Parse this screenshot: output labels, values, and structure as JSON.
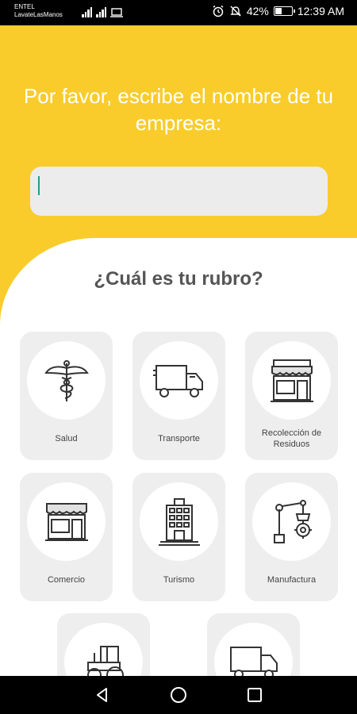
{
  "status_bar": {
    "carrier_line1": "ENTEL",
    "carrier_line2": "LavateLasManos",
    "battery_percent": "42%",
    "battery_level": 0.42,
    "time": "12:39 AM",
    "icons": [
      "signal-icon",
      "signal-4g-icon",
      "laptop-icon",
      "alarm-icon",
      "mute-icon",
      "battery-icon"
    ]
  },
  "header": {
    "prompt": "Por favor, escribe el nombre de tu empresa:",
    "company_input_value": "",
    "company_input_placeholder": ""
  },
  "main": {
    "question": "¿Cuál es tu rubro?",
    "categories": [
      {
        "label": "Salud",
        "icon": "caduceus-icon"
      },
      {
        "label": "Transporte",
        "icon": "truck-icon"
      },
      {
        "label": "Recolección de Residuos",
        "icon": "storefront-icon"
      },
      {
        "label": "Comercio",
        "icon": "shop-icon"
      },
      {
        "label": "Turismo",
        "icon": "hotel-icon"
      },
      {
        "label": "Manufactura",
        "icon": "robot-arm-icon"
      },
      {
        "label": "",
        "icon": "tractor-icon"
      },
      {
        "label": "",
        "icon": "truck-icon"
      }
    ]
  },
  "nav_bar": {
    "icons": [
      "back-icon",
      "home-icon",
      "recents-icon"
    ]
  },
  "colors": {
    "accent_yellow": "#f9cc2c",
    "card_bg": "#eeeeee",
    "input_bg": "#ececec",
    "caret": "#1c9e8c"
  }
}
